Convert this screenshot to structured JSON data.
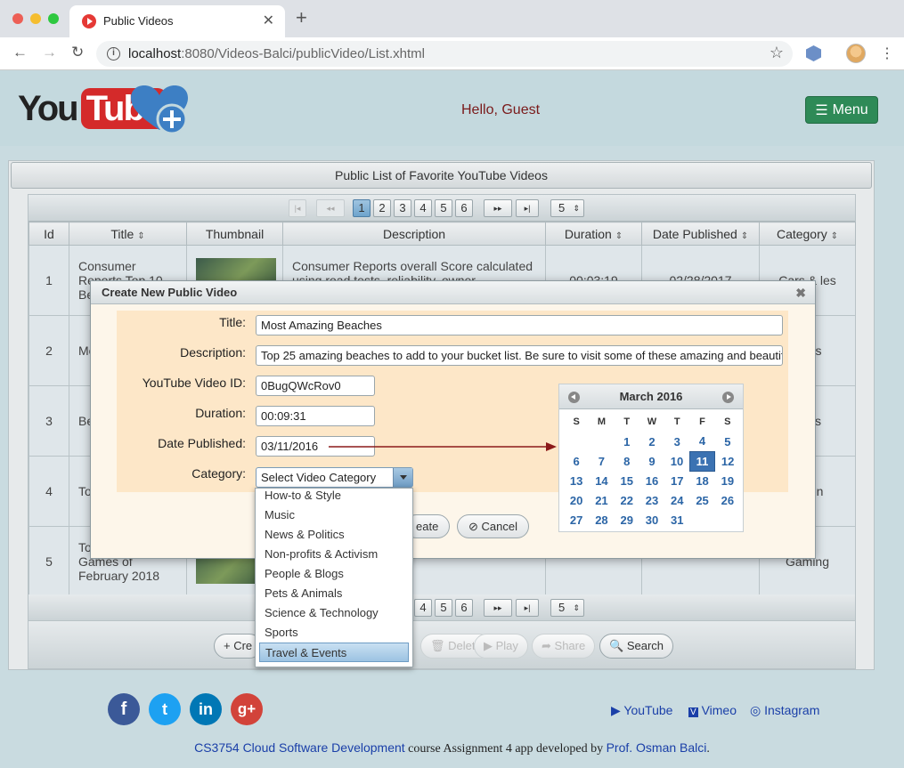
{
  "browser": {
    "tab_title": "Public Videos",
    "url_host": "localhost",
    "url_rest": ":8080/Videos-Balci/publicVideo/List.xhtml"
  },
  "header": {
    "logo_you": "You",
    "logo_tube": "Tube",
    "greeting": "Hello, Guest",
    "menu_label": "Menu"
  },
  "panel": {
    "title": "Public List of Favorite YouTube Videos",
    "pages": [
      "1",
      "2",
      "3",
      "4",
      "5",
      "6"
    ],
    "bottom_pages": [
      "4",
      "5",
      "6"
    ],
    "rows_per_page": "5",
    "columns": [
      "Id",
      "Title",
      "Thumbnail",
      "Description",
      "Duration",
      "Date Published",
      "Category"
    ],
    "rows": [
      {
        "id": "1",
        "title": "Consumer Reports Top 10 Be",
        "description": "Consumer Reports overall Score calculated using road tests, reliability, owner satisfaction",
        "duration": "00:03:19",
        "date": "02/28/2017",
        "category": "Cars & les"
      },
      {
        "id": "2",
        "title": "Me sp Gl",
        "description": "",
        "duration": "",
        "date": "",
        "category": "e & s"
      },
      {
        "id": "3",
        "title": "Be Vi",
        "description": "",
        "duration": "",
        "date": "",
        "category": "& als"
      },
      {
        "id": "4",
        "title": "To An",
        "description": "",
        "duration": "",
        "date": "",
        "category": "& tion"
      },
      {
        "id": "5",
        "title": "To Upcoming Games of February 2018",
        "description": "",
        "duration": "",
        "date": "",
        "category": "Gaming"
      }
    ],
    "toolbar": {
      "create": "+ Cre",
      "delete": "Delete",
      "play": "Play",
      "share": "Share",
      "search": "Search"
    }
  },
  "dialog": {
    "title": "Create New Public Video",
    "labels": {
      "title": "Title:",
      "description": "Description:",
      "video_id": "YouTube Video ID:",
      "duration": "Duration:",
      "date": "Date Published:",
      "category": "Category:"
    },
    "values": {
      "title": "Most Amazing Beaches",
      "description": "Top 25 amazing beaches to add to your bucket list. Be sure to visit some of these amazing and beautiful beac",
      "video_id": "0BugQWcRov0",
      "duration": "00:09:31",
      "date": "03/11/2016",
      "category": "Select Video Category"
    },
    "create_label": "eate",
    "cancel_label": "Cancel"
  },
  "dropdown": {
    "items": [
      "How-to & Style",
      "Music",
      "News & Politics",
      "Non-profits & Activism",
      "People & Blogs",
      "Pets & Animals",
      "Science & Technology",
      "Sports",
      "Travel & Events"
    ],
    "highlighted": "Travel & Events"
  },
  "calendar": {
    "month": "March 2016",
    "weekdays": [
      "S",
      "M",
      "T",
      "W",
      "T",
      "F",
      "S"
    ],
    "weeks": [
      [
        "",
        "",
        "1",
        "2",
        "3",
        "4",
        "5"
      ],
      [
        "6",
        "7",
        "8",
        "9",
        "10",
        "11",
        "12"
      ],
      [
        "13",
        "14",
        "15",
        "16",
        "17",
        "18",
        "19"
      ],
      [
        "20",
        "21",
        "22",
        "23",
        "24",
        "25",
        "26"
      ],
      [
        "27",
        "28",
        "29",
        "30",
        "31",
        "",
        ""
      ]
    ],
    "selected": "11"
  },
  "footer": {
    "social": [
      "f",
      "t",
      "in",
      "g+"
    ],
    "links": {
      "youtube": "YouTube",
      "vimeo": "Vimeo",
      "instagram": "Instagram"
    },
    "credit_course": "CS3754 Cloud Software Development",
    "credit_middle": " course Assignment 4 app developed by ",
    "credit_author": "Prof. Osman Balci",
    "credit_end": "."
  },
  "colors": {
    "accent": "#2e8a57",
    "selected_day": "#3b72b2",
    "link": "#1a3fa8"
  }
}
